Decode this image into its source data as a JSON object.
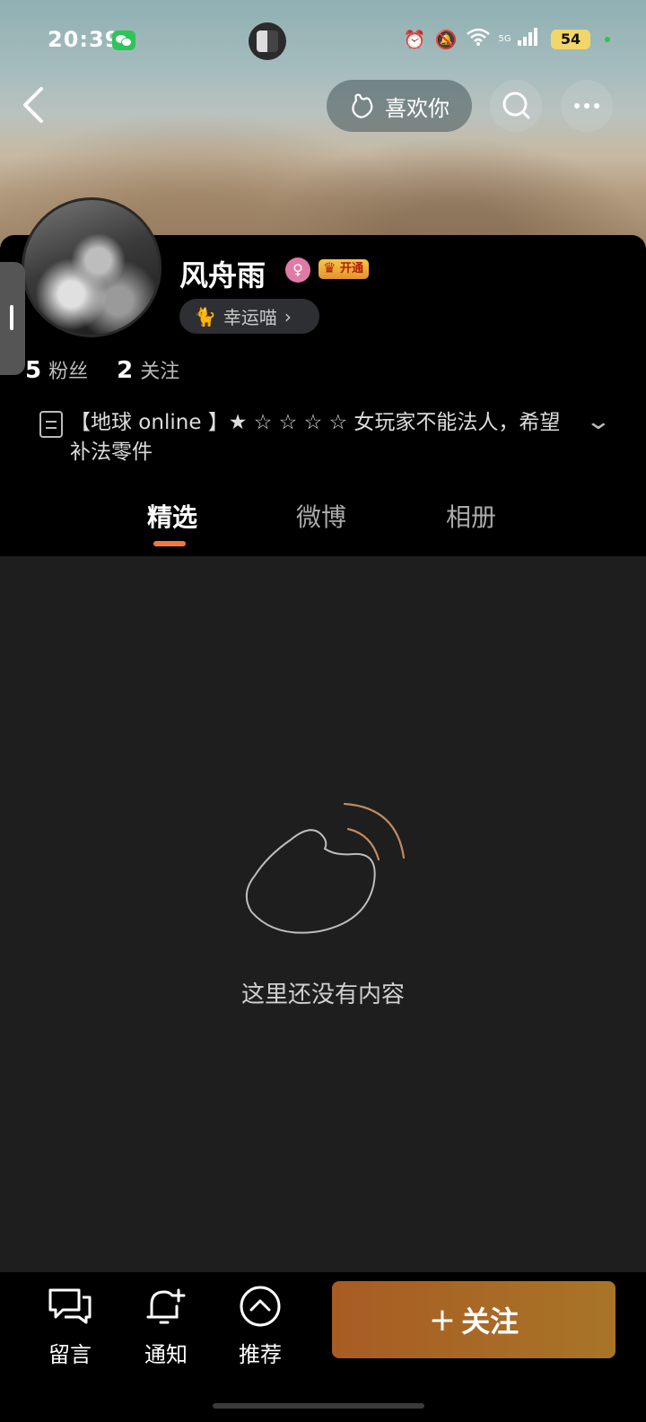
{
  "status_bar": {
    "time": "20:39",
    "network": "5G",
    "battery": "54"
  },
  "header": {
    "like_label": "喜欢你"
  },
  "profile": {
    "name": "风舟雨",
    "vip_label": "开通",
    "lucky_label": "幸运喵",
    "fans_count": "5",
    "fans_label": "粉丝",
    "following_count": "2",
    "following_label": "关注",
    "bio": "【地球 online 】★ ☆ ☆ ☆ ☆ 女玩家不能法人，希望补法零件"
  },
  "tabs": [
    {
      "label": "精选",
      "active": true
    },
    {
      "label": "微博",
      "active": false
    },
    {
      "label": "相册",
      "active": false
    }
  ],
  "empty_state": {
    "text": "这里还没有内容"
  },
  "bottom_bar": {
    "message_label": "留言",
    "notify_label": "通知",
    "recommend_label": "推荐",
    "follow_label": "关注",
    "follow_plus": "+"
  },
  "colors": {
    "accent": "#f07a3c",
    "follow_button": "#a86a25",
    "background": "#1e1e1e"
  }
}
